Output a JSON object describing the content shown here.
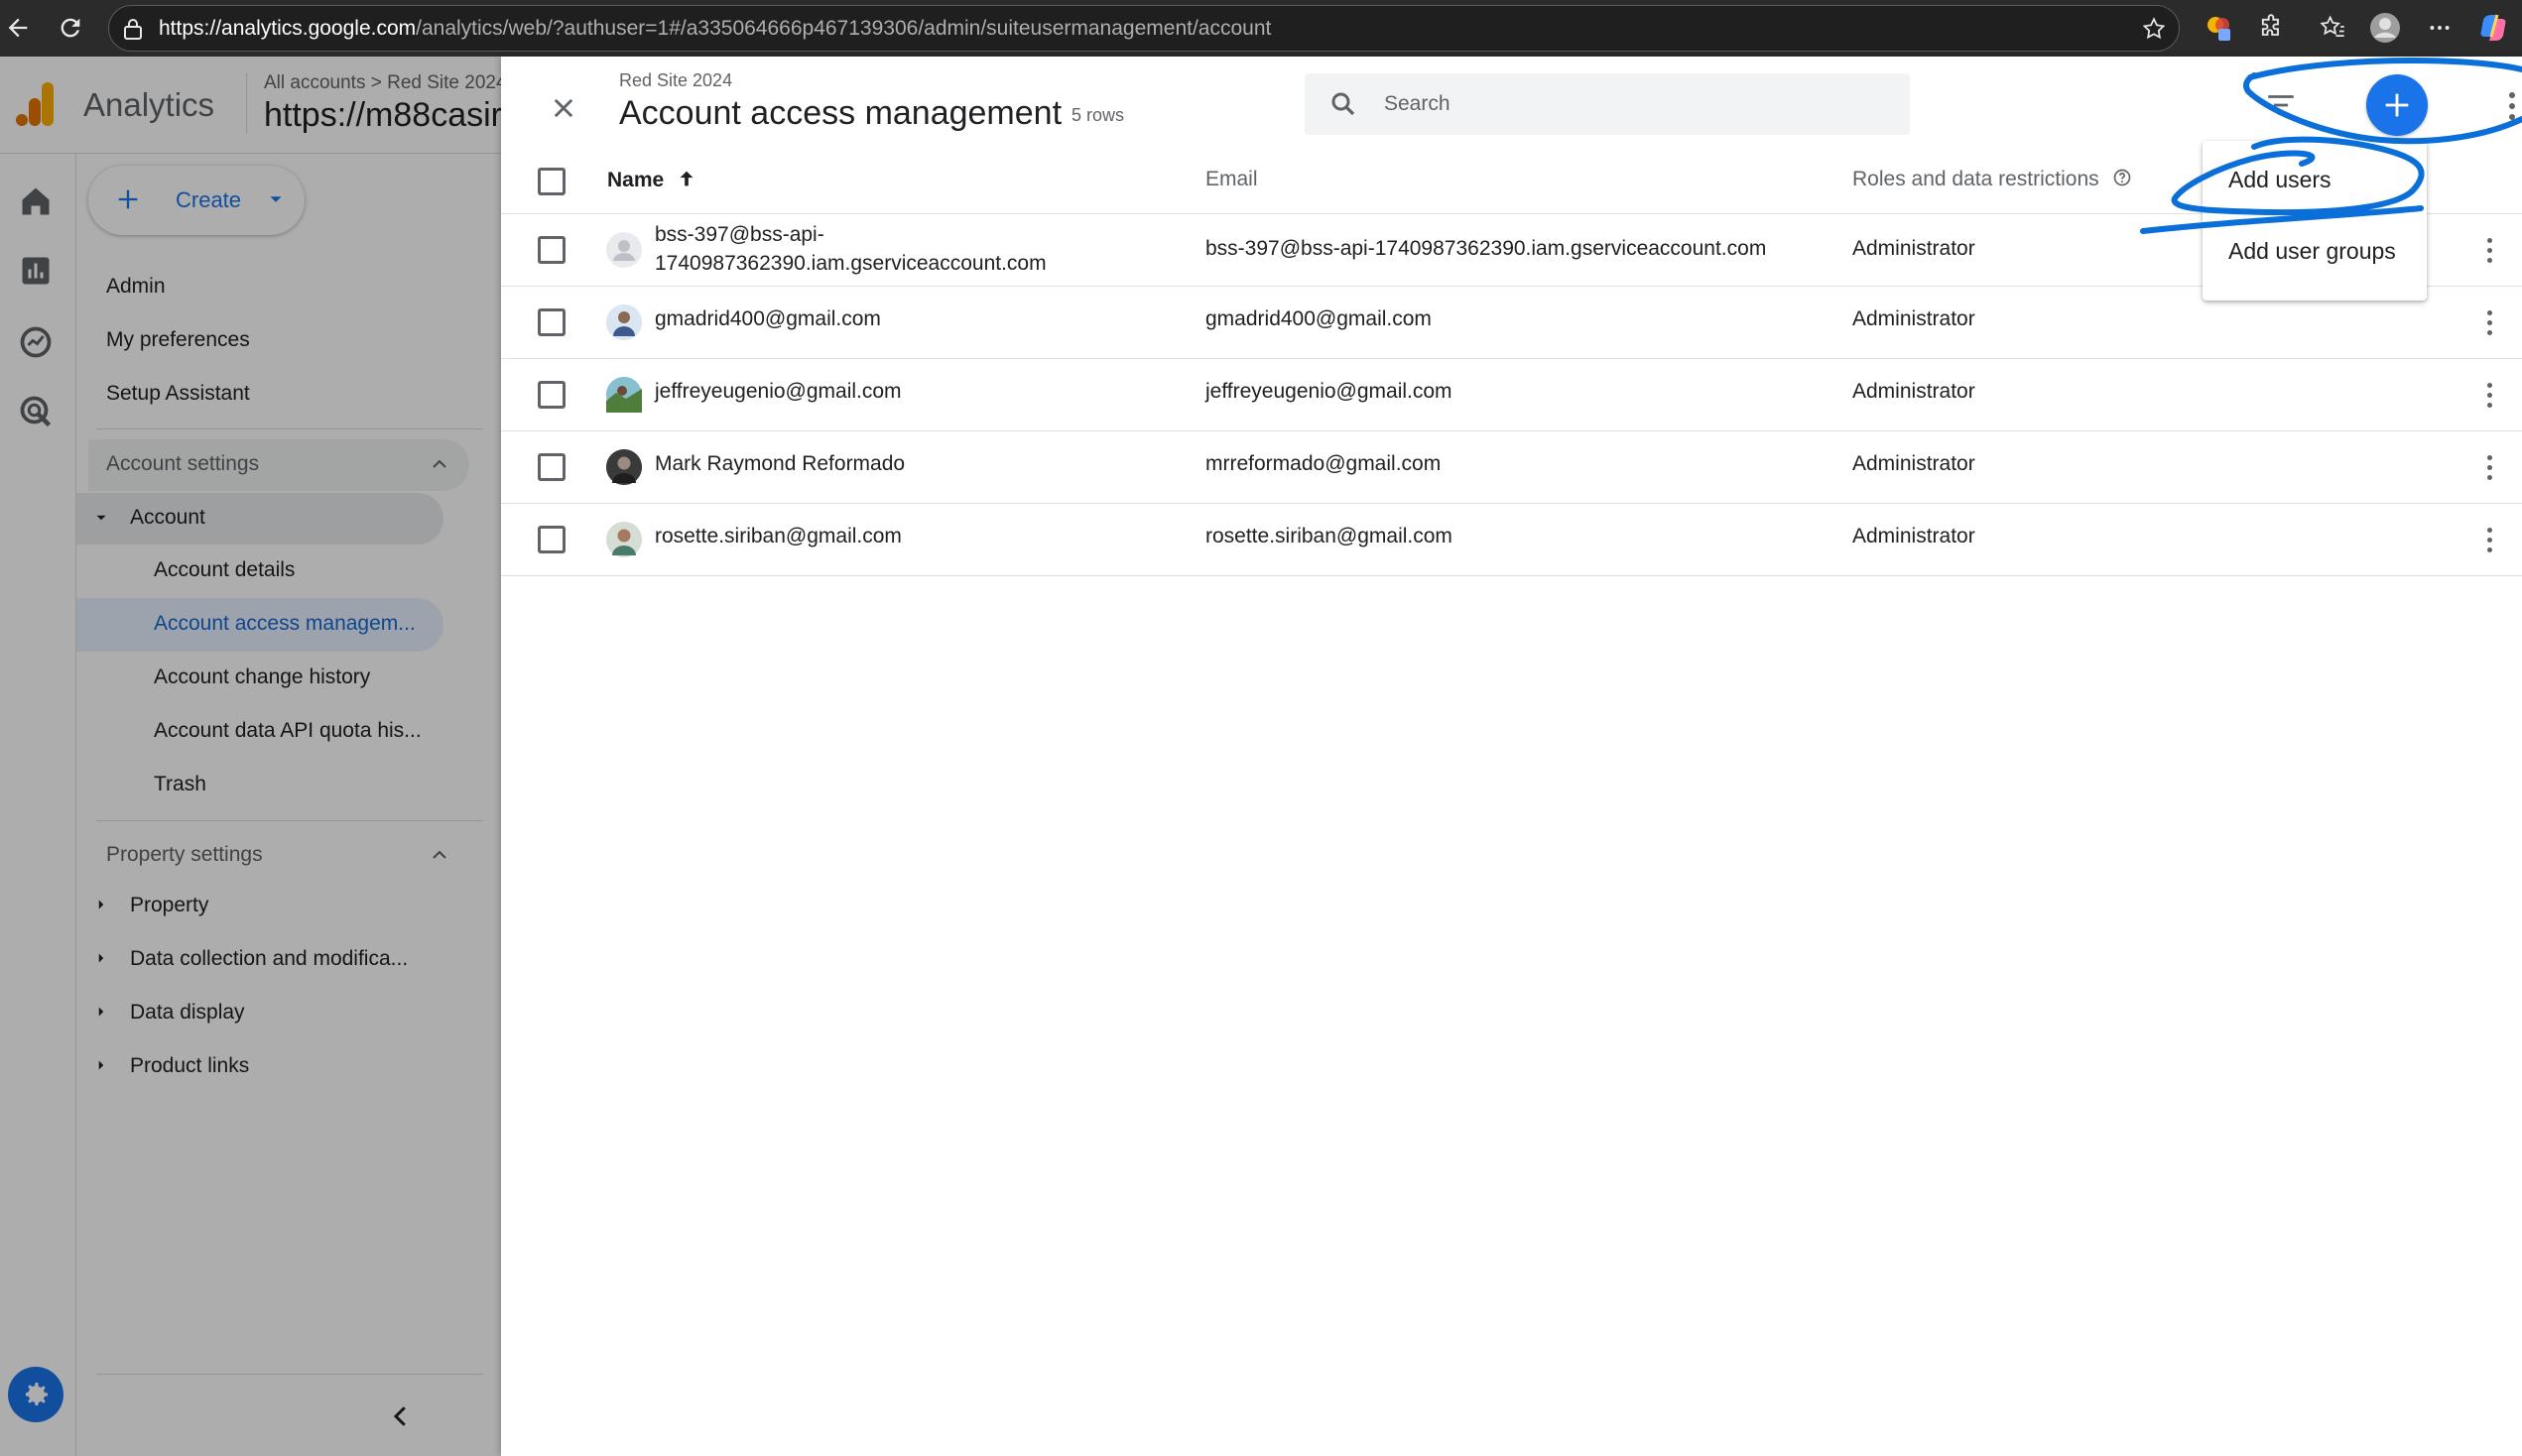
{
  "browser": {
    "url_host": "https://analytics.google.com",
    "url_path": "/analytics/web/?authuser=1#/a335064666p467139306/admin/suiteusermanagement/account"
  },
  "header": {
    "product": "Analytics",
    "breadcrumb_all": "All accounts",
    "breadcrumb_property": "Red Site 2024",
    "property_name": "https://m88casir"
  },
  "sidenav": {
    "create_label": "Create",
    "admin": "Admin",
    "my_preferences": "My preferences",
    "setup_assistant": "Setup Assistant",
    "account_settings": "Account settings",
    "account": "Account",
    "account_details": "Account details",
    "account_access": "Account access managem...",
    "account_change_history": "Account change history",
    "account_api_quota": "Account data API quota his...",
    "trash": "Trash",
    "property_settings": "Property settings",
    "property": "Property",
    "data_collection": "Data collection and modifica...",
    "data_display": "Data display",
    "product_links": "Product links"
  },
  "panel": {
    "subtitle": "Red Site 2024",
    "title": "Account access management",
    "rows_count": "5 rows",
    "search_placeholder": "Search",
    "columns": {
      "name": "Name",
      "email": "Email",
      "roles": "Roles and data restrictions"
    },
    "users": [
      {
        "name_line1": "bss-397@bss-api-",
        "name_line2": "1740987362390.iam.gserviceaccount.com",
        "email": "bss-397@bss-api-1740987362390.iam.gserviceaccount.com",
        "role": "Administrator"
      },
      {
        "name": "gmadrid400@gmail.com",
        "email": "gmadrid400@gmail.com",
        "role": "Administrator"
      },
      {
        "name": "jeffreyeugenio@gmail.com",
        "email": "jeffreyeugenio@gmail.com",
        "role": "Administrator"
      },
      {
        "name": "Mark Raymond Reformado",
        "email": "mrreformado@gmail.com",
        "role": "Administrator"
      },
      {
        "name": "rosette.siriban@gmail.com",
        "email": "rosette.siriban@gmail.com",
        "role": "Administrator"
      }
    ]
  },
  "menu": {
    "add_users": "Add users",
    "add_user_groups": "Add user groups"
  },
  "colors": {
    "accent": "#1a73e8",
    "annotation": "#0a6fd8",
    "ga_orange": "#f9ab00",
    "ga_dark_orange": "#e37400"
  }
}
